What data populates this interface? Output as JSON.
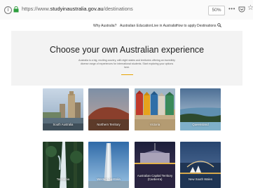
{
  "browser": {
    "url_prefix": "https://www.",
    "url_domain": "studyinaustralia.gov.au",
    "url_path": "/destinations",
    "zoom": "50%",
    "more_label": "•••"
  },
  "nav": {
    "items": [
      {
        "label": "Why Australia?"
      },
      {
        "label": "Australian Education"
      },
      {
        "label": "Live in Australia"
      },
      {
        "label": "How to apply"
      },
      {
        "label": "Destinations"
      }
    ]
  },
  "hero": {
    "title": "Choose your own Australian experience",
    "intro": "Australia is a big, exciting country, with eight states and territories offering an incredibly diverse range of experiences for international students. Start exploring your options here."
  },
  "destinations": [
    {
      "label": "South Australia"
    },
    {
      "label": "Northern Territory"
    },
    {
      "label": "Victoria"
    },
    {
      "label": "Queensland"
    },
    {
      "label": "Tasmania"
    },
    {
      "label": "Western Australia"
    },
    {
      "label": "Australian Capital Territory (Canberra)"
    },
    {
      "label": "New South Wales"
    }
  ],
  "colors": {
    "accent": "#e7a300",
    "hero_bg": "#f3f3f3",
    "lock_green": "#2e9e3e"
  }
}
